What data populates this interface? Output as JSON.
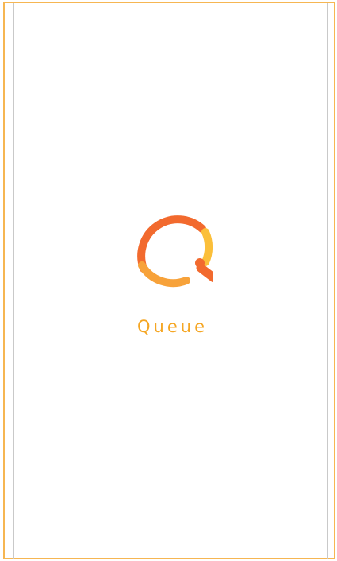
{
  "app": {
    "name": "Queue",
    "logo_icon": "queue-q-logo-icon"
  },
  "colors": {
    "brand_orange": "#f5a623",
    "logo_red_orange": "#f26a2e",
    "logo_orange": "#f7a23a",
    "logo_yellow": "#fbbf3a",
    "frame_border": "#f6b652",
    "background": "#ffffff"
  }
}
